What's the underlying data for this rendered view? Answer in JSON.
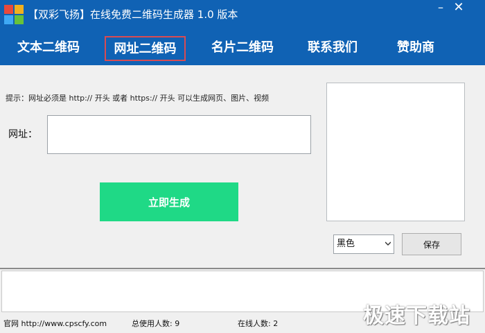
{
  "window": {
    "title": "【双彩飞扬】在线免费二维码生成器 1.0 版本",
    "minimize": "–",
    "close": "✕",
    "logo_colors": [
      "#e84a3c",
      "#f2b01e",
      "#3fa9f5",
      "#67c23a"
    ]
  },
  "tabs": [
    {
      "label": "文本二维码",
      "active": false
    },
    {
      "label": "网址二维码",
      "active": true
    },
    {
      "label": "名片二维码",
      "active": false
    },
    {
      "label": "联系我们",
      "active": false
    },
    {
      "label": "赞助商",
      "active": false
    }
  ],
  "main": {
    "hint": "提示：网址必须是 http:// 开头 或者 https:// 开头  可以生成网页、图片、视频",
    "url_label": "网址：",
    "url_value": "",
    "generate_label": "立即生成",
    "color_selected": "黑色",
    "save_label": "保存"
  },
  "status": {
    "site": "官网 http://www.cpscfy.com",
    "total_users": "总使用人数: 9",
    "online_users": "在线人数: 2"
  },
  "watermark": "极速下载站",
  "colors": {
    "primary": "#1062b4",
    "accent_green": "#1fd986",
    "active_tab_border": "#d94b52"
  }
}
